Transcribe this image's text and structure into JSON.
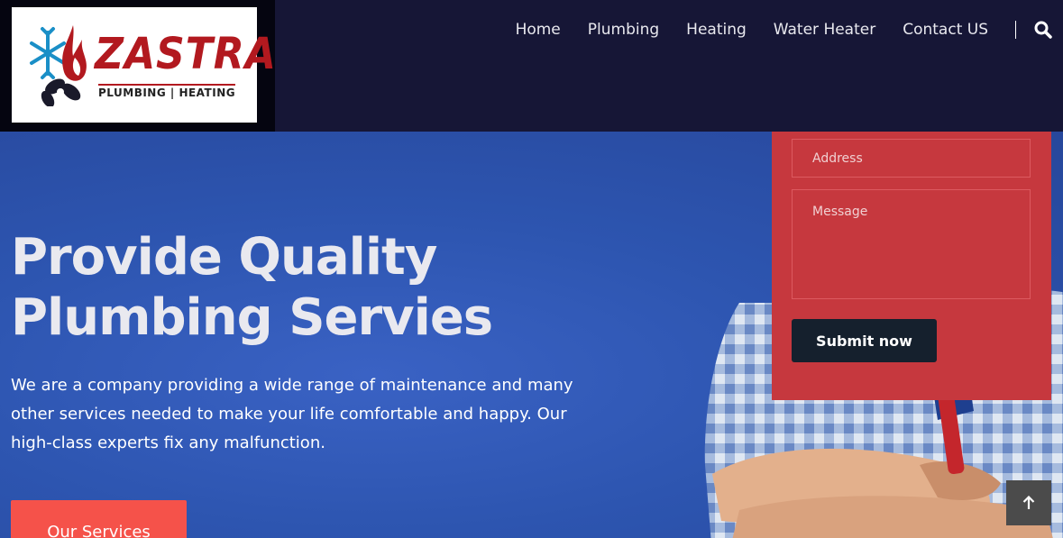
{
  "logo": {
    "name": "ZASTRA",
    "tagline": "PLUMBING | HEATING"
  },
  "nav": {
    "items": [
      {
        "label": "Home"
      },
      {
        "label": "Plumbing"
      },
      {
        "label": "Heating"
      },
      {
        "label": "Water Heater"
      },
      {
        "label": "Contact US"
      }
    ]
  },
  "hero": {
    "title_line1": "Provide Quality",
    "title_line2": "Plumbing Servies",
    "description": "We are a company providing a wide range of maintenance and many other services needed to make your life comfortable and happy. Our high-class experts fix any malfunction.",
    "cta_label": "Our Services"
  },
  "form": {
    "address_placeholder": "Address",
    "message_placeholder": "Message",
    "submit_label": "Submit now"
  },
  "icons": {
    "search": "search-icon",
    "back_to_top": "arrow-up-icon"
  },
  "colors": {
    "header_bg": "#161636",
    "hero_bg": "#2d55b0",
    "form_bg": "#c6383e",
    "cta_bg": "#f5524a",
    "submit_bg": "#15202d",
    "brand_red": "#b2191f"
  }
}
